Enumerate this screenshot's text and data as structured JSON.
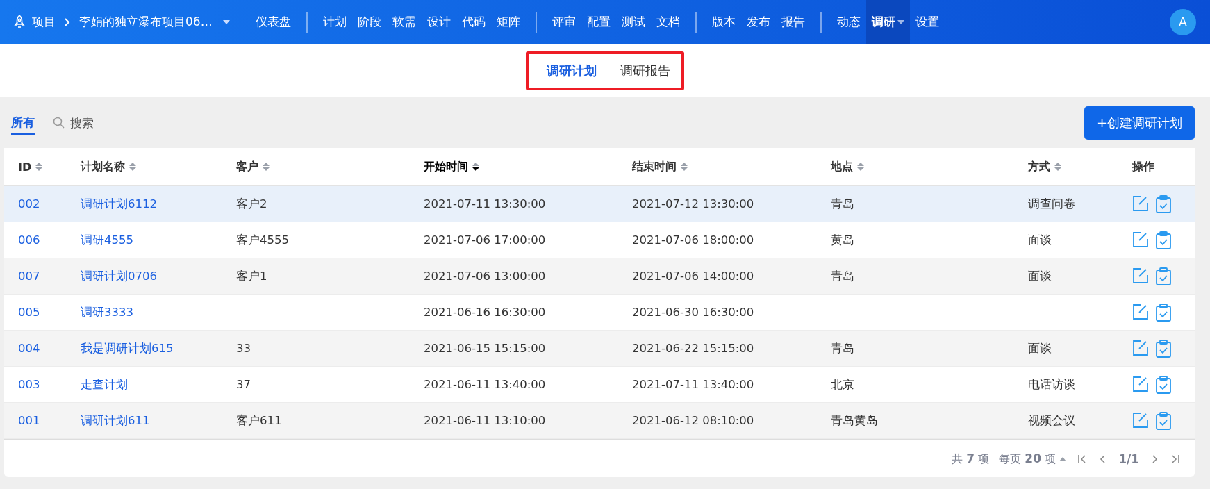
{
  "header": {
    "project_label": "项目",
    "breadcrumb": "李娟的独立瀑布项目06…",
    "nav_groups": [
      [
        {
          "label": "仪表盘",
          "selected": false,
          "has_menu": false
        }
      ],
      [
        {
          "label": "计划",
          "selected": false,
          "has_menu": false
        },
        {
          "label": "阶段",
          "selected": false,
          "has_menu": false
        },
        {
          "label": "软需",
          "selected": false,
          "has_menu": false
        },
        {
          "label": "设计",
          "selected": false,
          "has_menu": false
        },
        {
          "label": "代码",
          "selected": false,
          "has_menu": false
        },
        {
          "label": "矩阵",
          "selected": false,
          "has_menu": false
        }
      ],
      [
        {
          "label": "评审",
          "selected": false,
          "has_menu": false
        },
        {
          "label": "配置",
          "selected": false,
          "has_menu": false
        },
        {
          "label": "测试",
          "selected": false,
          "has_menu": false
        },
        {
          "label": "文档",
          "selected": false,
          "has_menu": false
        }
      ],
      [
        {
          "label": "版本",
          "selected": false,
          "has_menu": false
        },
        {
          "label": "发布",
          "selected": false,
          "has_menu": false
        },
        {
          "label": "报告",
          "selected": false,
          "has_menu": false
        }
      ],
      [
        {
          "label": "动态",
          "selected": false,
          "has_menu": false
        },
        {
          "label": "调研",
          "selected": true,
          "has_menu": true
        },
        {
          "label": "设置",
          "selected": false,
          "has_menu": false
        }
      ]
    ],
    "avatar": "A"
  },
  "subtabs": {
    "highlighted": true,
    "items": [
      {
        "label": "调研计划",
        "selected": true
      },
      {
        "label": "调研报告",
        "selected": false
      }
    ]
  },
  "toolbar": {
    "filters": [
      {
        "label": "所有",
        "selected": true
      }
    ],
    "search": {
      "placeholder": "搜索"
    },
    "create_button": "+创建调研计划"
  },
  "table": {
    "columns": [
      {
        "label": "ID",
        "sortable": true,
        "sorted_descending": false
      },
      {
        "label": "计划名称",
        "sortable": true,
        "sorted_descending": false
      },
      {
        "label": "客户",
        "sortable": true,
        "sorted_descending": false
      },
      {
        "label": "开始时间",
        "sortable": true,
        "sorted_descending": true
      },
      {
        "label": "结束时间",
        "sortable": true,
        "sorted_descending": false
      },
      {
        "label": "地点",
        "sortable": true,
        "sorted_descending": false
      },
      {
        "label": "方式",
        "sortable": true,
        "sorted_descending": false
      },
      {
        "label": "操作",
        "sortable": false,
        "sorted_descending": false
      }
    ],
    "rows": [
      {
        "selected": true,
        "cells": [
          "002",
          "调研计划6112",
          "客户2",
          "2021-07-11 13:30:00",
          "2021-07-12 13:30:00",
          "青岛",
          "调查问卷"
        ]
      },
      {
        "selected": false,
        "cells": [
          "006",
          "调研4555",
          "客户4555",
          "2021-07-06 17:00:00",
          "2021-07-06 18:00:00",
          "黄岛",
          "面谈"
        ]
      },
      {
        "selected": false,
        "cells": [
          "007",
          "调研计划0706",
          "客户1",
          "2021-07-06 13:00:00",
          "2021-07-06 14:00:00",
          "青岛",
          "面谈"
        ]
      },
      {
        "selected": false,
        "cells": [
          "005",
          "调研3333",
          "",
          "2021-06-16 16:30:00",
          "2021-06-30 16:30:00",
          "",
          ""
        ]
      },
      {
        "selected": false,
        "cells": [
          "004",
          "我是调研计划615",
          "33",
          "2021-06-15 15:15:00",
          "2021-06-22 15:15:00",
          "青岛",
          "面谈"
        ]
      },
      {
        "selected": false,
        "cells": [
          "003",
          "走查计划",
          "37",
          "2021-06-11 13:40:00",
          "2021-07-11 13:40:00",
          "北京",
          "电话访谈"
        ]
      },
      {
        "selected": false,
        "cells": [
          "001",
          "调研计划611",
          "客户611",
          "2021-06-11 13:10:00",
          "2021-06-12 08:10:00",
          "青岛黄岛",
          "视频会议"
        ]
      }
    ]
  },
  "pager": {
    "total": "共 **7** 项",
    "per_page": "每页 **20** 项",
    "page": "1/1"
  }
}
